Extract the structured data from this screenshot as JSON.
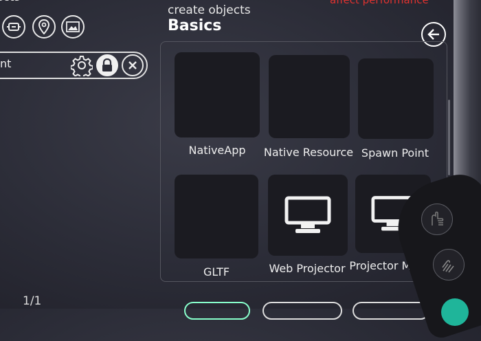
{
  "header": {
    "warning_text": "affect performance",
    "subtitle": "create objects",
    "title": "Basics"
  },
  "left_panel": {
    "title_fragment": "ects",
    "search_text": "nt",
    "pager": "1/1"
  },
  "tiles": [
    {
      "label": "NativeApp",
      "icon": "none"
    },
    {
      "label": "Native Resource",
      "icon": "none"
    },
    {
      "label": "Spawn Point",
      "icon": "none"
    },
    {
      "label": "GLTF",
      "icon": "none"
    },
    {
      "label": "Web Projector",
      "icon": "monitor-icon"
    },
    {
      "label": "Projector Mirror",
      "icon": "monitor-icon"
    }
  ],
  "colors": {
    "background": "#2b2c37",
    "tile": "#1b1b21",
    "warning": "#e0322f"
  }
}
